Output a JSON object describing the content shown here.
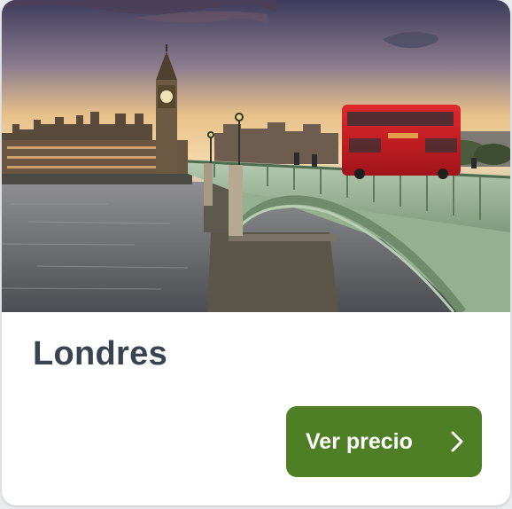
{
  "card": {
    "image_alt": "Westminster Bridge and Big Ben at sunset with a red double-decker bus",
    "city": "Londres",
    "button_label": "Ver precio",
    "button_icon": "chevron-right-icon"
  },
  "colors": {
    "button_bg": "#4f7f25",
    "title_text": "#38444f",
    "bus_red": "#c9191f"
  }
}
